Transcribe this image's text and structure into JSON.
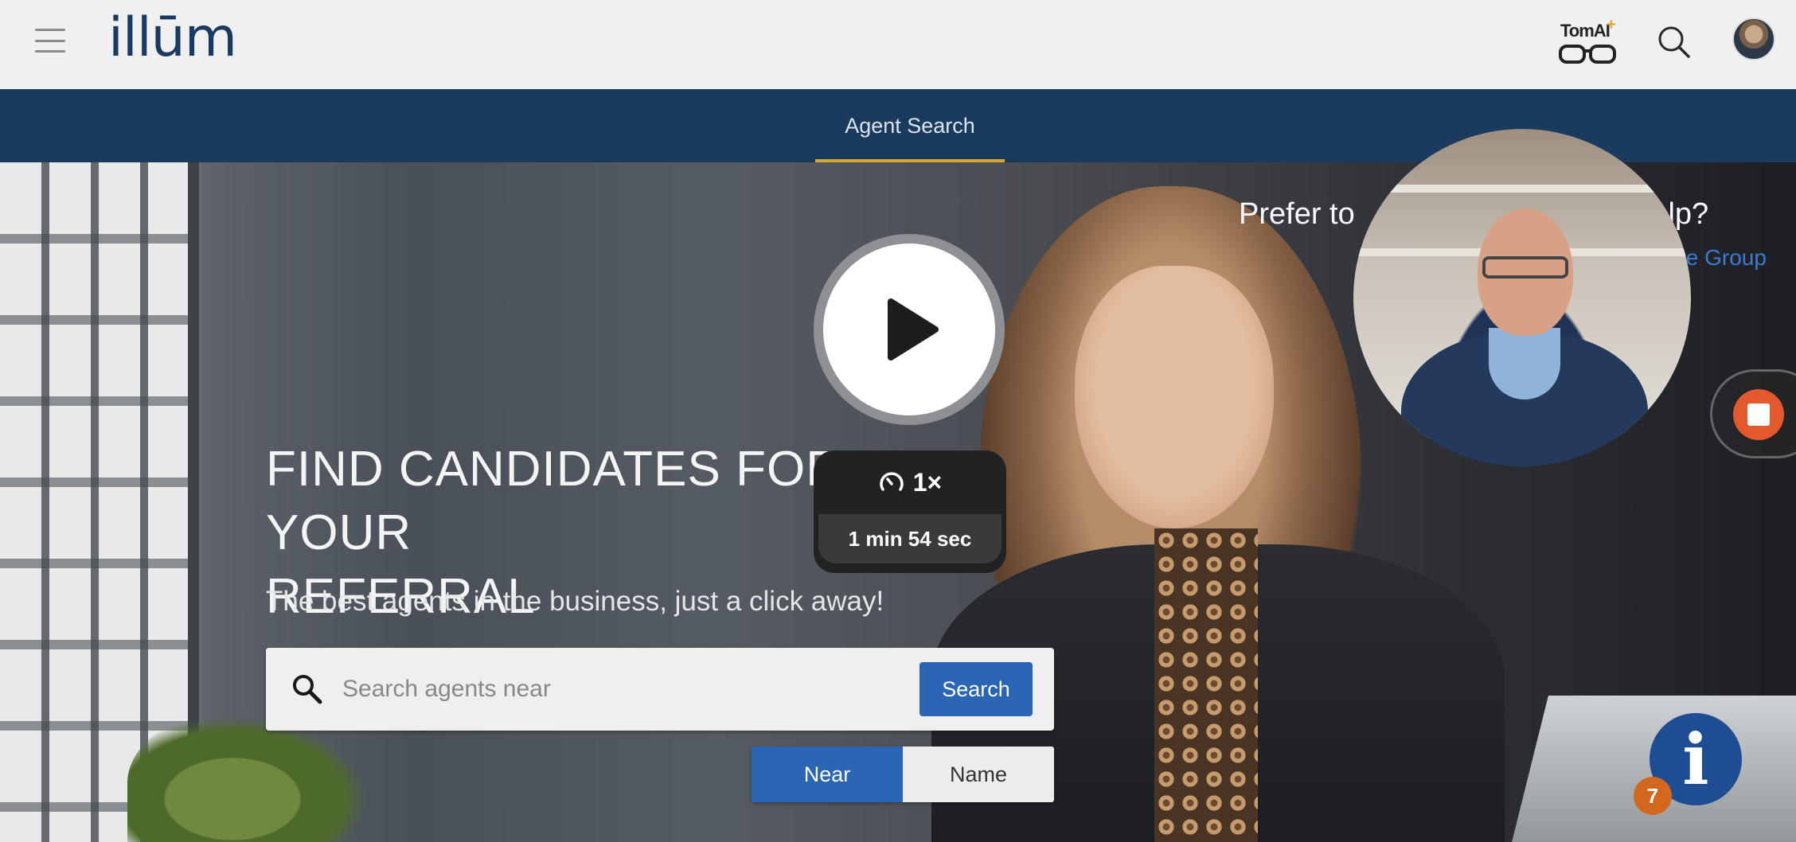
{
  "header": {
    "logo_text": "illūm",
    "tomai_label": "TomAI",
    "tomai_plus": "+"
  },
  "nav": {
    "tabs": [
      {
        "label": "Agent Search"
      }
    ]
  },
  "hero": {
    "title_line1": "FIND CANDIDATES FOR YOUR",
    "title_line2": "REFERRAL",
    "subtitle": "The best agents in the business, just a click away!",
    "search": {
      "placeholder": "Search agents near",
      "button_label": "Search"
    },
    "toggle": {
      "near_label": "Near",
      "name_label": "Name",
      "selected": "Near"
    },
    "help": {
      "title_left": "Prefer to",
      "title_right": "r help?",
      "link": "te Group"
    }
  },
  "video_overlay": {
    "speed": "1×",
    "duration": "1 min 54 sec"
  },
  "info_widget": {
    "icon": "i",
    "badge_count": "7"
  },
  "colors": {
    "nav_bg": "#1a3a5e",
    "accent": "#d4a73a",
    "primary_button": "#2a66b4",
    "record_stop": "#e3582c",
    "badge": "#d4671e"
  }
}
